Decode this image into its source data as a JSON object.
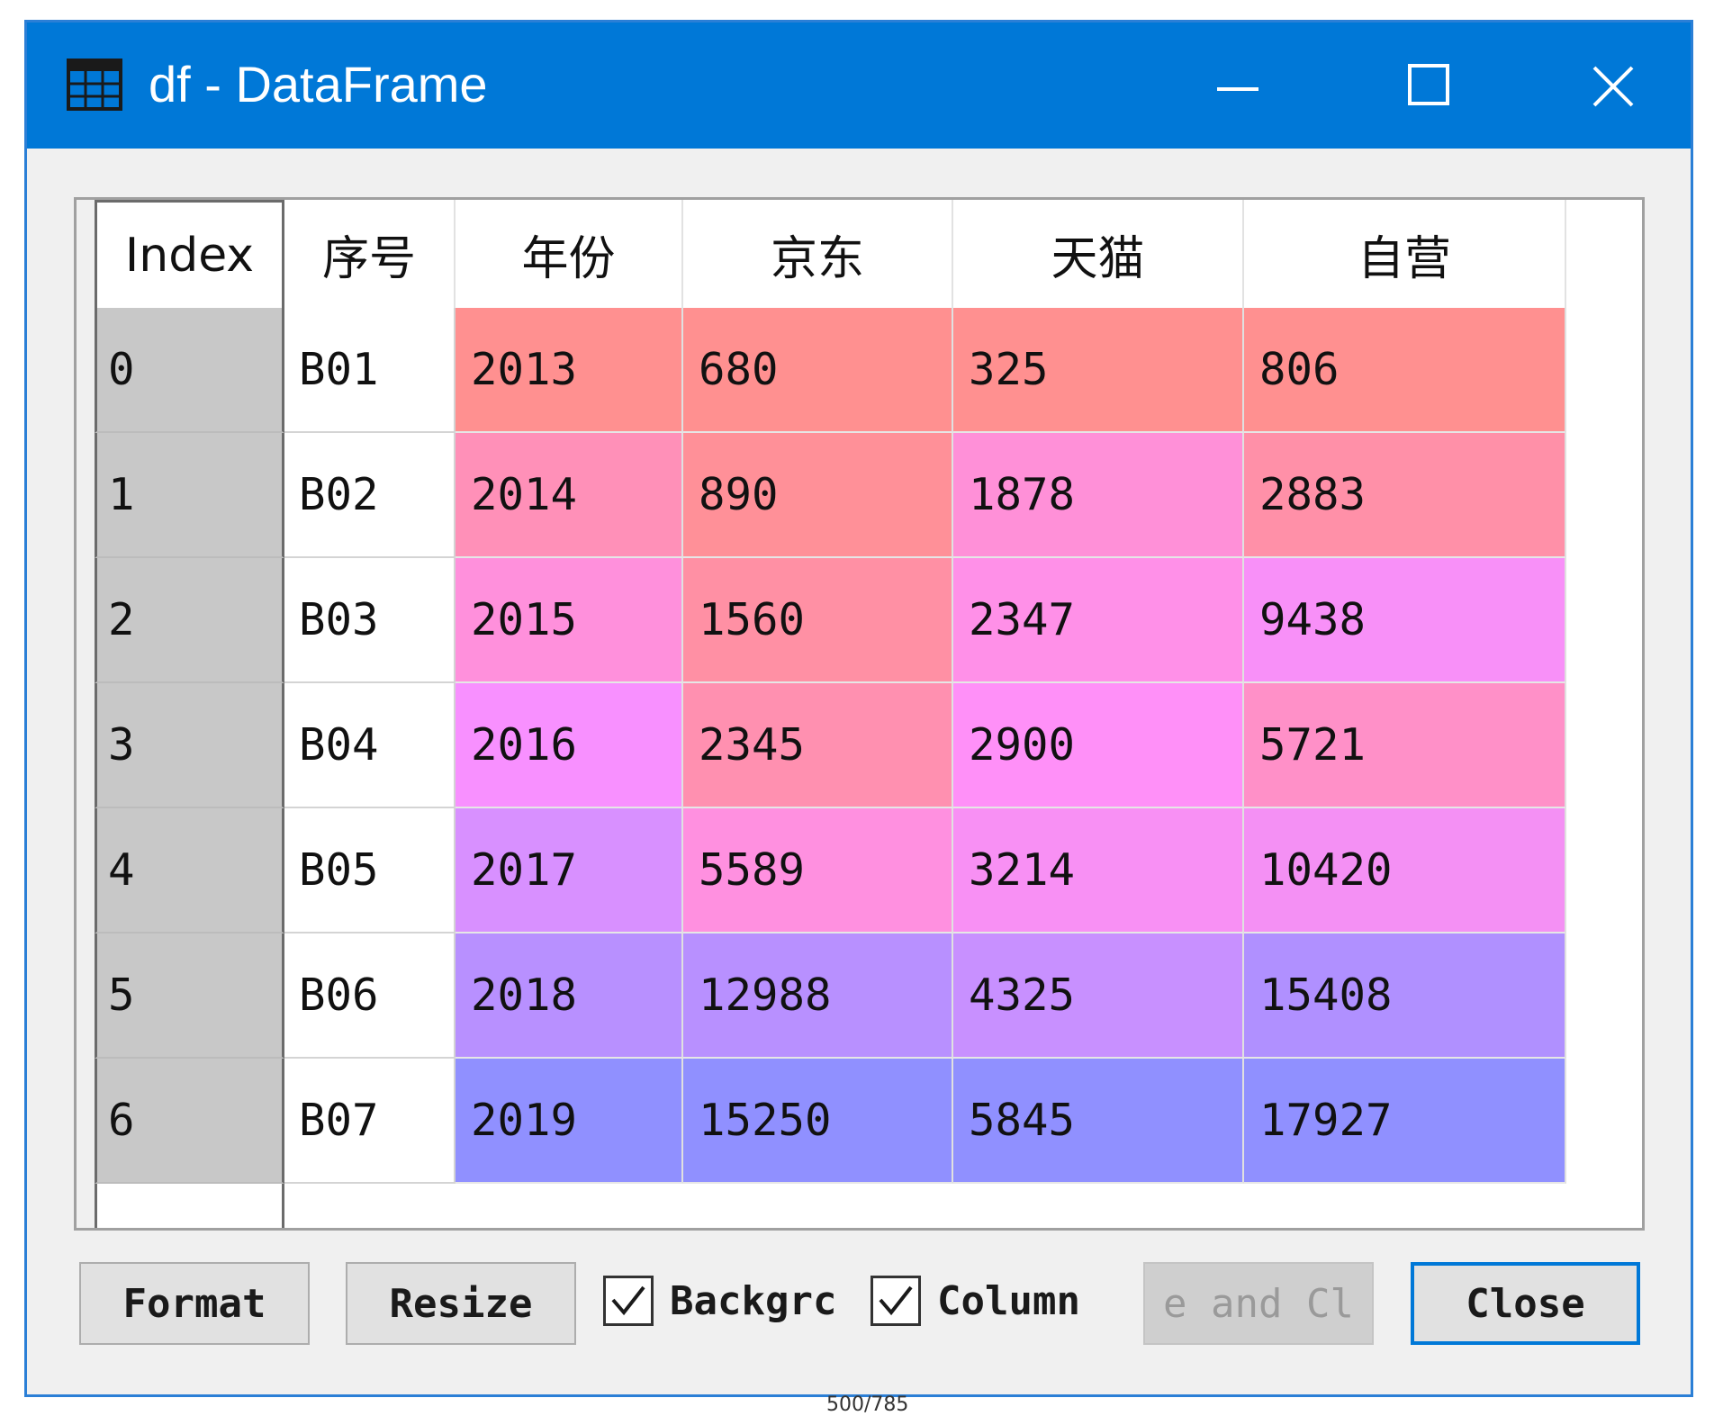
{
  "window": {
    "title": "df - DataFrame",
    "icons": {
      "app": "table-grid-icon",
      "minimize": "minimize-icon",
      "maximize": "maximize-icon",
      "close": "close-icon"
    },
    "accent_color": "#0078d7"
  },
  "table": {
    "headers": [
      "Index",
      "序号",
      "年份",
      "京东",
      "天猫",
      "自营"
    ],
    "rows": [
      {
        "index": "0",
        "seq": "B01",
        "values": [
          "2013",
          "680",
          "325",
          "806"
        ],
        "colors": [
          "#ff9090",
          "#ff9090",
          "#ff9090",
          "#ff9090"
        ]
      },
      {
        "index": "1",
        "seq": "B02",
        "values": [
          "2014",
          "890",
          "1878",
          "2883"
        ],
        "colors": [
          "#ff90b8",
          "#ff9098",
          "#ff90d8",
          "#ff90a8"
        ]
      },
      {
        "index": "2",
        "seq": "B03",
        "values": [
          "2015",
          "1560",
          "2347",
          "9438"
        ],
        "colors": [
          "#ff90dc",
          "#ff90a4",
          "#ff90e8",
          "#f890f8"
        ]
      },
      {
        "index": "3",
        "seq": "B04",
        "values": [
          "2016",
          "2345",
          "2900",
          "5721"
        ],
        "colors": [
          "#f890ff",
          "#ff90b0",
          "#ff90f8",
          "#ff90c8"
        ]
      },
      {
        "index": "4",
        "seq": "B05",
        "values": [
          "2017",
          "5589",
          "3214",
          "10420"
        ],
        "colors": [
          "#d890ff",
          "#ff90e0",
          "#f890f4",
          "#f490f4"
        ]
      },
      {
        "index": "5",
        "seq": "B06",
        "values": [
          "2018",
          "12988",
          "4325",
          "15408"
        ],
        "colors": [
          "#b890ff",
          "#b890ff",
          "#c890ff",
          "#b090ff"
        ]
      },
      {
        "index": "6",
        "seq": "B07",
        "values": [
          "2019",
          "15250",
          "5845",
          "17927"
        ],
        "colors": [
          "#9090ff",
          "#9090ff",
          "#9090ff",
          "#9090ff"
        ]
      }
    ]
  },
  "buttons": {
    "format": "Format",
    "resize": "Resize",
    "save_close": "e  and Cl",
    "close": "Close"
  },
  "checkboxes": {
    "background": {
      "label": "Backgrc",
      "checked": true
    },
    "column": {
      "label": "Column",
      "checked": true
    }
  },
  "footer": "500/785"
}
